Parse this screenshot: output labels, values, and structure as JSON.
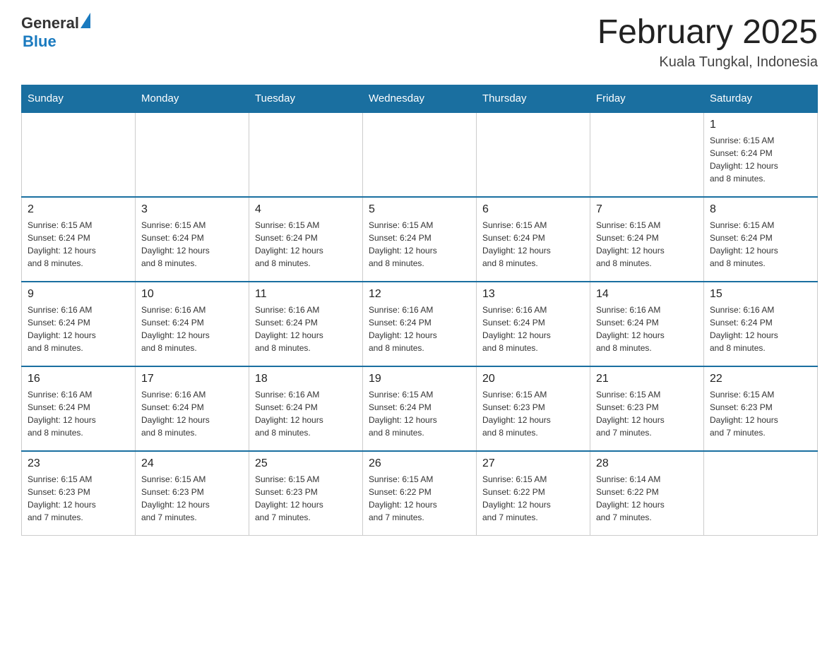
{
  "header": {
    "logo_general": "General",
    "logo_blue": "Blue",
    "month_title": "February 2025",
    "location": "Kuala Tungkal, Indonesia"
  },
  "weekdays": [
    "Sunday",
    "Monday",
    "Tuesday",
    "Wednesday",
    "Thursday",
    "Friday",
    "Saturday"
  ],
  "weeks": [
    [
      {
        "day": "",
        "info": ""
      },
      {
        "day": "",
        "info": ""
      },
      {
        "day": "",
        "info": ""
      },
      {
        "day": "",
        "info": ""
      },
      {
        "day": "",
        "info": ""
      },
      {
        "day": "",
        "info": ""
      },
      {
        "day": "1",
        "info": "Sunrise: 6:15 AM\nSunset: 6:24 PM\nDaylight: 12 hours\nand 8 minutes."
      }
    ],
    [
      {
        "day": "2",
        "info": "Sunrise: 6:15 AM\nSunset: 6:24 PM\nDaylight: 12 hours\nand 8 minutes."
      },
      {
        "day": "3",
        "info": "Sunrise: 6:15 AM\nSunset: 6:24 PM\nDaylight: 12 hours\nand 8 minutes."
      },
      {
        "day": "4",
        "info": "Sunrise: 6:15 AM\nSunset: 6:24 PM\nDaylight: 12 hours\nand 8 minutes."
      },
      {
        "day": "5",
        "info": "Sunrise: 6:15 AM\nSunset: 6:24 PM\nDaylight: 12 hours\nand 8 minutes."
      },
      {
        "day": "6",
        "info": "Sunrise: 6:15 AM\nSunset: 6:24 PM\nDaylight: 12 hours\nand 8 minutes."
      },
      {
        "day": "7",
        "info": "Sunrise: 6:15 AM\nSunset: 6:24 PM\nDaylight: 12 hours\nand 8 minutes."
      },
      {
        "day": "8",
        "info": "Sunrise: 6:15 AM\nSunset: 6:24 PM\nDaylight: 12 hours\nand 8 minutes."
      }
    ],
    [
      {
        "day": "9",
        "info": "Sunrise: 6:16 AM\nSunset: 6:24 PM\nDaylight: 12 hours\nand 8 minutes."
      },
      {
        "day": "10",
        "info": "Sunrise: 6:16 AM\nSunset: 6:24 PM\nDaylight: 12 hours\nand 8 minutes."
      },
      {
        "day": "11",
        "info": "Sunrise: 6:16 AM\nSunset: 6:24 PM\nDaylight: 12 hours\nand 8 minutes."
      },
      {
        "day": "12",
        "info": "Sunrise: 6:16 AM\nSunset: 6:24 PM\nDaylight: 12 hours\nand 8 minutes."
      },
      {
        "day": "13",
        "info": "Sunrise: 6:16 AM\nSunset: 6:24 PM\nDaylight: 12 hours\nand 8 minutes."
      },
      {
        "day": "14",
        "info": "Sunrise: 6:16 AM\nSunset: 6:24 PM\nDaylight: 12 hours\nand 8 minutes."
      },
      {
        "day": "15",
        "info": "Sunrise: 6:16 AM\nSunset: 6:24 PM\nDaylight: 12 hours\nand 8 minutes."
      }
    ],
    [
      {
        "day": "16",
        "info": "Sunrise: 6:16 AM\nSunset: 6:24 PM\nDaylight: 12 hours\nand 8 minutes."
      },
      {
        "day": "17",
        "info": "Sunrise: 6:16 AM\nSunset: 6:24 PM\nDaylight: 12 hours\nand 8 minutes."
      },
      {
        "day": "18",
        "info": "Sunrise: 6:16 AM\nSunset: 6:24 PM\nDaylight: 12 hours\nand 8 minutes."
      },
      {
        "day": "19",
        "info": "Sunrise: 6:15 AM\nSunset: 6:24 PM\nDaylight: 12 hours\nand 8 minutes."
      },
      {
        "day": "20",
        "info": "Sunrise: 6:15 AM\nSunset: 6:23 PM\nDaylight: 12 hours\nand 8 minutes."
      },
      {
        "day": "21",
        "info": "Sunrise: 6:15 AM\nSunset: 6:23 PM\nDaylight: 12 hours\nand 7 minutes."
      },
      {
        "day": "22",
        "info": "Sunrise: 6:15 AM\nSunset: 6:23 PM\nDaylight: 12 hours\nand 7 minutes."
      }
    ],
    [
      {
        "day": "23",
        "info": "Sunrise: 6:15 AM\nSunset: 6:23 PM\nDaylight: 12 hours\nand 7 minutes."
      },
      {
        "day": "24",
        "info": "Sunrise: 6:15 AM\nSunset: 6:23 PM\nDaylight: 12 hours\nand 7 minutes."
      },
      {
        "day": "25",
        "info": "Sunrise: 6:15 AM\nSunset: 6:23 PM\nDaylight: 12 hours\nand 7 minutes."
      },
      {
        "day": "26",
        "info": "Sunrise: 6:15 AM\nSunset: 6:22 PM\nDaylight: 12 hours\nand 7 minutes."
      },
      {
        "day": "27",
        "info": "Sunrise: 6:15 AM\nSunset: 6:22 PM\nDaylight: 12 hours\nand 7 minutes."
      },
      {
        "day": "28",
        "info": "Sunrise: 6:14 AM\nSunset: 6:22 PM\nDaylight: 12 hours\nand 7 minutes."
      },
      {
        "day": "",
        "info": ""
      }
    ]
  ]
}
